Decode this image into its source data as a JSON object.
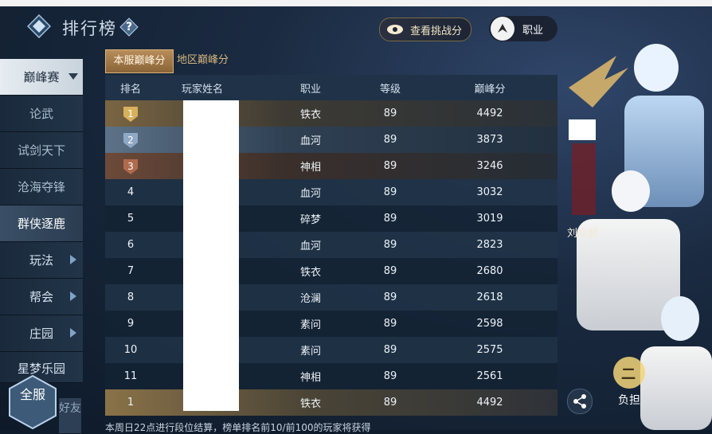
{
  "header": {
    "title": "排行榜",
    "help_label": "?",
    "score_button": "查看挑战分",
    "job_button": "职业"
  },
  "sidebar": {
    "items": [
      {
        "label": "巅峰赛",
        "state": "active",
        "has_dropdown": true
      },
      {
        "label": "论武",
        "state": "normal"
      },
      {
        "label": "试剑天下",
        "state": "normal"
      },
      {
        "label": "沧海夺锋",
        "state": "normal"
      },
      {
        "label": "群侠逐鹿",
        "state": "highlight"
      },
      {
        "label": "玩法",
        "state": "normal",
        "has_arrow": true
      },
      {
        "label": "帮会",
        "state": "normal",
        "has_arrow": true
      },
      {
        "label": "庄园",
        "state": "normal",
        "has_arrow": true
      },
      {
        "label": "星梦乐园",
        "state": "normal"
      }
    ]
  },
  "bottom_left": {
    "all_server": "全服",
    "friends": "好友"
  },
  "tabs": [
    {
      "label": "本服巅峰分",
      "active": true
    },
    {
      "label": "地区巅峰分",
      "active": false
    }
  ],
  "table": {
    "headers": [
      "排名",
      "玩家姓名",
      "职业",
      "等级",
      "巅峰分"
    ],
    "rows": [
      {
        "rank": "1",
        "job": "铁衣",
        "level": "89",
        "score": "4492",
        "style": "gold"
      },
      {
        "rank": "2",
        "job": "血河",
        "level": "89",
        "score": "3873",
        "style": "silver"
      },
      {
        "rank": "3",
        "job": "神相",
        "level": "89",
        "score": "3246",
        "style": "bronze"
      },
      {
        "rank": "4",
        "job": "血河",
        "level": "89",
        "score": "3032",
        "style": "even"
      },
      {
        "rank": "5",
        "job": "碎梦",
        "level": "89",
        "score": "3019",
        "style": "odd"
      },
      {
        "rank": "6",
        "job": "血河",
        "level": "89",
        "score": "2823",
        "style": "even"
      },
      {
        "rank": "7",
        "job": "铁衣",
        "level": "89",
        "score": "2680",
        "style": "odd"
      },
      {
        "rank": "8",
        "job": "沧澜",
        "level": "89",
        "score": "2618",
        "style": "even"
      },
      {
        "rank": "9",
        "job": "素问",
        "level": "89",
        "score": "2598",
        "style": "odd"
      },
      {
        "rank": "10",
        "job": "素问",
        "level": "89",
        "score": "2575",
        "style": "even"
      },
      {
        "rank": "11",
        "job": "神相",
        "level": "89",
        "score": "2561",
        "style": "odd"
      }
    ],
    "self_row": {
      "rank": "1",
      "job": "铁衣",
      "level": "89",
      "score": "4492"
    }
  },
  "right": {
    "player_name": "刘众赫",
    "burden_label": "负担",
    "burden_badge": "二"
  },
  "footer_note": "本周日22点进行段位结算，榜单排名前10/前100的玩家将获得",
  "colors": {
    "gold": "#b88d5a",
    "accent_text": "#d7b780",
    "background": "#0f1c2c"
  }
}
